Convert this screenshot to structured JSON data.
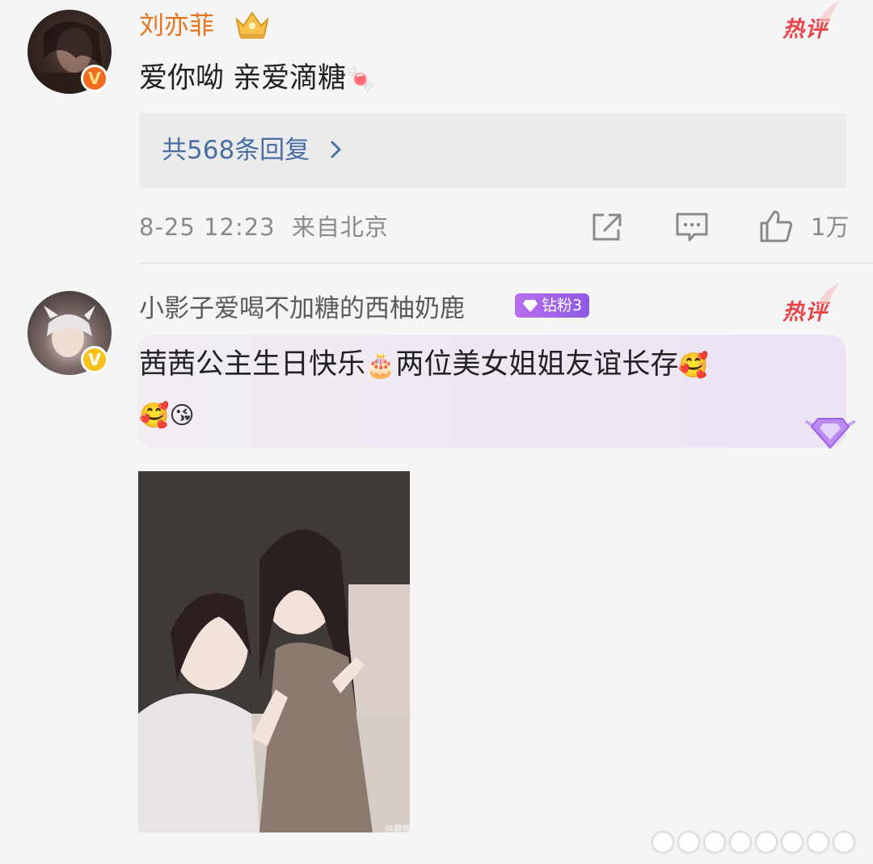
{
  "comments": [
    {
      "username": "刘亦菲",
      "hot_label": "热评",
      "content": "爱你呦 亲爱滴糖",
      "content_emoji": "🍬",
      "replies_label": "共568条回复",
      "timestamp": "8-25 12:23",
      "location": "来自北京",
      "like_count": "1万"
    },
    {
      "username": "小影子爱喝不加糖的西柚奶鹿",
      "fan_badge": "钻粉3",
      "hot_label": "热评",
      "content_line1": "茜茜公主生日快乐",
      "emoji_cake": "🎂",
      "content_line1b": "两位美女姐姐友谊长存",
      "emoji_line1_end": "🥰",
      "emoji_line2a": "🥰",
      "emoji_line2b": "😘",
      "image_watermark": "@趣娱"
    }
  ],
  "colors": {
    "vip_name": "#e5731f",
    "hot": "#e8454a",
    "link": "#4a6fa3",
    "fan_badge": "#a064e8"
  },
  "icons": [
    "crown-badge-icon",
    "verified-red-icon",
    "verified-gold-icon",
    "share-icon",
    "comment-icon",
    "like-icon",
    "diamond-icon",
    "chevron-right-icon"
  ]
}
